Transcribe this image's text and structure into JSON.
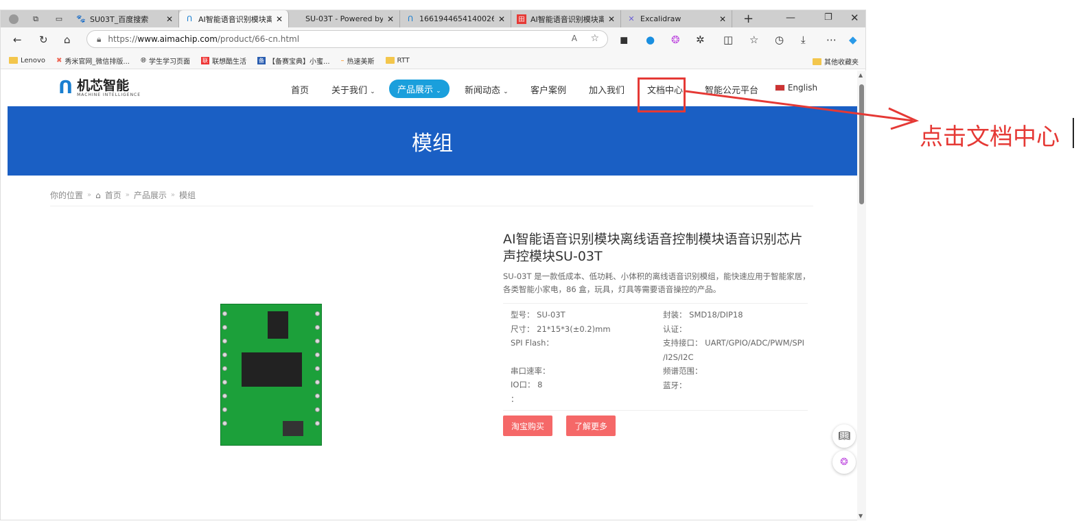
{
  "browser": {
    "tabs": [
      {
        "title": "SU03T_百度搜索",
        "icon": "baidu-icon"
      },
      {
        "title": "AI智能语音识别模块离线",
        "icon": "aimachip-icon",
        "active": true
      },
      {
        "title": "SU-03T - Powered by MI",
        "icon": "none"
      },
      {
        "title": "1661944654140026.pdf",
        "icon": "aimachip-icon"
      },
      {
        "title": "AI智能语音识别模块离线",
        "icon": "red-app-icon"
      },
      {
        "title": "Excalidraw",
        "icon": "excalidraw-icon"
      }
    ],
    "url_prefix": "https://",
    "url_host": "www.aimachip.com",
    "url_path": "/product/66-cn.html",
    "bookmarks": [
      "Lenovo",
      "秀米官网_微信排版...",
      "学生学习页面",
      "联想酷生活",
      "【备赛宝典】小蜜...",
      "热速美斯",
      "RTT"
    ],
    "other_bookmarks": "其他收藏夹"
  },
  "site": {
    "logo_cn": "机芯智能",
    "logo_en": "MACHINE INTELLIGENCE",
    "nav": [
      "首页",
      "关于我们",
      "产品展示",
      "新闻动态",
      "客户案例",
      "加入我们",
      "文档中心",
      "智能公元平台",
      "English"
    ],
    "banner_title": "模组",
    "breadcrumb": [
      "你的位置",
      "首页",
      "产品展示",
      "模组"
    ],
    "product": {
      "title": "AI智能语音识别模块离线语音控制模块语音识别芯片声控模块SU-03T",
      "description": "SU-03T 是一款低成本、低功耗、小体积的离线语音识别模组，能快速应用于智能家居，各类智能小家电，86 盒，玩具，灯具等需要语音操控的产品。",
      "specs_left": [
        "型号：  SU-03T",
        "尺寸：  21*15*3(±0.2)mm",
        "SPI Flash：",
        "串口速率：",
        "IO口：  8",
        "："
      ],
      "specs_right": [
        "封装：  SMD18/DIP18",
        "认证：",
        "支持接口：  UART/GPIO/ADC/PWM/SPI",
        "/I2S/I2C",
        "频谱范围：",
        "蓝牙："
      ],
      "buy_label": "淘宝购买",
      "more_label": "了解更多"
    }
  },
  "annotation": {
    "text": "点击文档中心",
    "color": "#e53935"
  },
  "colors": {
    "banner": "#1a5fc4",
    "nav_active": "#1a9fdc",
    "button": "#f56868"
  }
}
